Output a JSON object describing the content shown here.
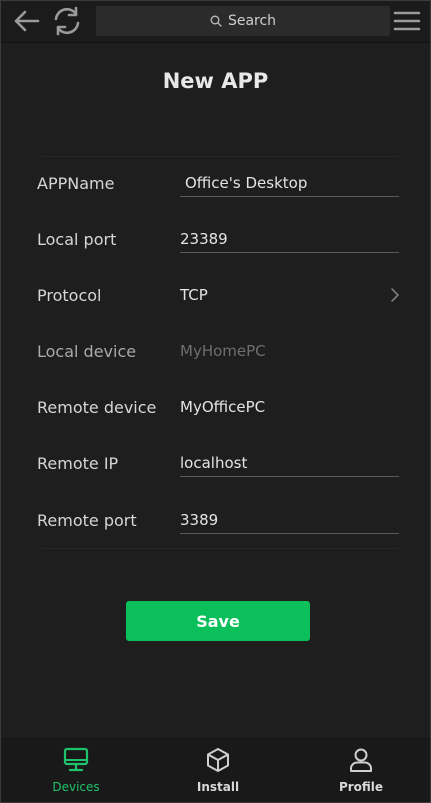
{
  "topbar": {
    "back_icon": "arrow-left-icon",
    "refresh_icon": "refresh-icon",
    "menu_icon": "hamburger-icon",
    "search_placeholder": "Search"
  },
  "page": {
    "title": "New APP"
  },
  "form": {
    "app_name": {
      "label": "APPName",
      "value": "Office's Desktop"
    },
    "local_port": {
      "label": "Local port",
      "value": "23389"
    },
    "protocol": {
      "label": "Protocol",
      "value": "TCP"
    },
    "local_device": {
      "label": "Local device",
      "value": "MyHomePC"
    },
    "remote_device": {
      "label": "Remote device",
      "value": "MyOfficePC"
    },
    "remote_ip": {
      "label": "Remote IP",
      "value": "localhost"
    },
    "remote_port": {
      "label": "Remote port",
      "value": "3389"
    }
  },
  "actions": {
    "save_label": "Save"
  },
  "bottom_nav": {
    "items": [
      {
        "label": "Devices",
        "icon": "monitor-icon",
        "active": true
      },
      {
        "label": "Install",
        "icon": "box-icon",
        "active": false
      },
      {
        "label": "Profile",
        "icon": "user-icon",
        "active": false
      }
    ]
  },
  "colors": {
    "accent": "#0bbf5a",
    "active_nav": "#1ec26a",
    "background": "#1e1e1e"
  }
}
